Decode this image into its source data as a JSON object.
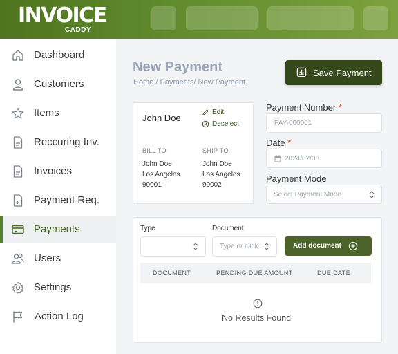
{
  "brand": {
    "name": "INVOICE",
    "sub": "CADDY"
  },
  "sidebar": {
    "items": [
      {
        "label": "Dashboard",
        "icon": "home-icon"
      },
      {
        "label": "Customers",
        "icon": "user-icon"
      },
      {
        "label": "Items",
        "icon": "star-icon"
      },
      {
        "label": "Reccuring Inv.",
        "icon": "document-icon"
      },
      {
        "label": "Invoices",
        "icon": "document-icon"
      },
      {
        "label": "Payment Req.",
        "icon": "document-return-icon"
      },
      {
        "label": "Payments",
        "icon": "credit-card-icon",
        "active": true
      },
      {
        "label": "Users",
        "icon": "users-icon"
      },
      {
        "label": "Settings",
        "icon": "gear-icon"
      },
      {
        "label": "Action Log",
        "icon": "flag-icon"
      }
    ]
  },
  "page": {
    "title": "New Payment",
    "breadcrumb": "Home / Payments/ New Payment",
    "save_label": "Save Payment"
  },
  "customer": {
    "name": "John Doe",
    "edit_label": "Edit",
    "deselect_label": "Deselect",
    "bill_to": {
      "heading": "BILL TO",
      "lines": [
        "John Doe",
        "Los Angeles",
        "90001"
      ]
    },
    "ship_to": {
      "heading": "SHIP TO",
      "lines": [
        "John Doe",
        "Los Angeles",
        "90002"
      ]
    }
  },
  "form": {
    "payment_number": {
      "label": "Payment Number",
      "required_mark": "*",
      "placeholder": "PAY-000001"
    },
    "date": {
      "label": "Date",
      "required_mark": "*",
      "value": "2024/02/08"
    },
    "payment_mode": {
      "label": "Payment Mode",
      "placeholder": "Select Payment Mode"
    }
  },
  "documents": {
    "type_label": "Type",
    "document_label": "Document",
    "document_placeholder": "Type or click",
    "add_label": "Add document",
    "columns": [
      "DOCUMENT",
      "PENDING DUE AMOUNT",
      "DUE DATE"
    ],
    "empty_text": "No Results Found"
  },
  "colors": {
    "brand_green": "#5f8a2c",
    "dark_button": "#35491b",
    "accent_text": "#4c6b25",
    "required": "#d33a2c"
  }
}
